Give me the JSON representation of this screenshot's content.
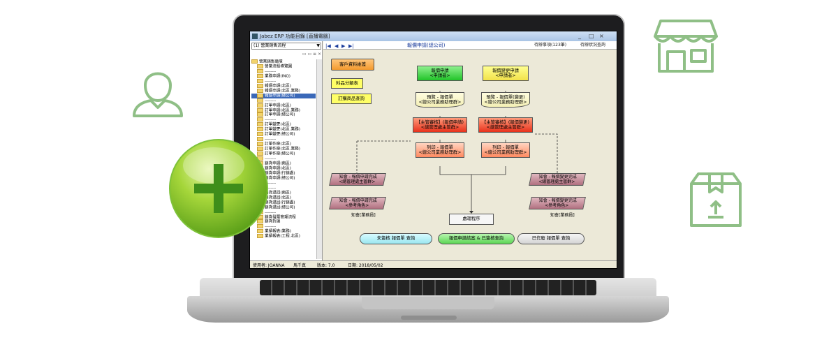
{
  "window": {
    "title": "Jabez ERP 功能目錄 [直播電腦]",
    "min": "_",
    "max": "□",
    "close": "×"
  },
  "sidebar": {
    "combo_value": "(1) 營業銷售流程",
    "toolbar_icons": "▭ ▭  ≡ ×",
    "items": [
      "營業銷售循環",
      "營業流程導覽圖",
      "--------",
      "業務申請(INQ)",
      "--------",
      "報價申請(北區)",
      "報價申請(北區.業務)",
      "報價申請(總公司)",
      "--------",
      "訂單申請(北區)",
      "訂單申請(北區.業務)",
      "訂單申請(總公司)",
      "--------",
      "訂單變更(北區)",
      "訂單變更(北區.業務)",
      "訂單變更(總公司)",
      "--------",
      "訂單作廢(北區)",
      "訂單作廢(北區.業務)",
      "訂單作廢(總公司)",
      "--------",
      "銷貨申請(南區)",
      "銷貨申請(北區)",
      "銷貨申請(行銷處)",
      "銷貨申請(總公司)",
      "--------",
      "--------",
      "銷貨退回(南區)",
      "銷貨退回(北區)",
      "銷貨退回(行銷處)",
      "銷貨退回(總公司)",
      "--------",
      "銷貨發票管理流程",
      "銷貨折讓",
      "--------",
      "業績報表(業務)",
      "業績報表(工程.北區)"
    ],
    "selected_index": 7
  },
  "navbar": {
    "first": "|◀",
    "prev": "◀",
    "next": "▶",
    "last": "▶|",
    "title": "報價申請(總公司)",
    "pending": "待辦事項(123筆)",
    "status_query": "待辦狀況查詢"
  },
  "flow": {
    "customer_data": "客戶資料維護",
    "material_table": "料品分類表",
    "order_query": "訂購商品查詢",
    "quote_apply": [
      "報價申請",
      "<申請者>"
    ],
    "quote_change": [
      "報價變更申請",
      "<申請者>"
    ],
    "preview1": [
      "預覽 - 報價單",
      "<總公司業務助理群>"
    ],
    "preview2": [
      "預覽 - 報價單(變更)",
      "<總公司業務助理群>"
    ],
    "approve1": [
      "【主管審核】(報價申請)",
      "<總管理處主管群>"
    ],
    "approve2": [
      "【主管審核】(報價變更)",
      "<總管理處主管群>"
    ],
    "print1": [
      "列印 - 報價單",
      "<總公司業務助理群>"
    ],
    "print2": [
      "列印 - 報價單",
      "<總公司業務助理群>"
    ],
    "notify1": [
      "知會 - 報價申請完成",
      "<總管理處主管群>"
    ],
    "notify2": [
      "知會 - 報價申請完成",
      "<參考角色>"
    ],
    "notify3": [
      "知會 - 報價變更完成",
      "<總管理處主管群>"
    ],
    "notify4": [
      "知會 - 報價變更完成",
      "<參考角色>"
    ],
    "notify_sales1": "知會[業務員]",
    "notify_sales2": "知會[業務員]",
    "process": "處理程序",
    "btn_unsigned": "未簽核 報價單 查詢",
    "btn_finished": "報價申請結案 & 已簽核查詢",
    "btn_voided": "已作廢 報價單 查詢"
  },
  "statusbar": {
    "user": "使用者: JOANNA",
    "name": "馬千真",
    "version": "版本: 7.0",
    "date": "日期: 2018/05/02"
  },
  "colors": {
    "deco_green": "#8fbf86",
    "plus_green": "#7ec23a"
  },
  "icons": [
    "user-outline-icon",
    "plus-circle-icon",
    "shop-icon",
    "package-box-icon"
  ]
}
